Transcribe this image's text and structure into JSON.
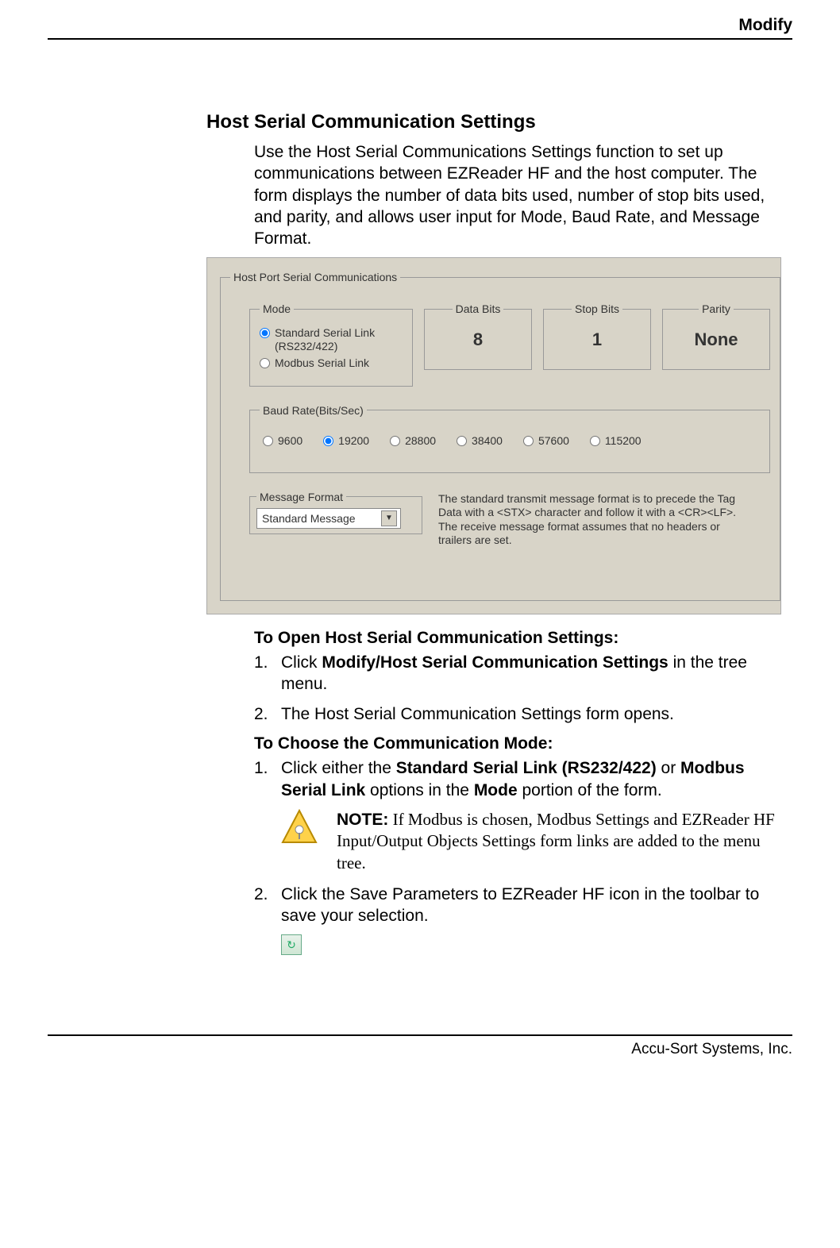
{
  "header": {
    "title": "Modify"
  },
  "section": {
    "title": "Host Serial Communication Settings",
    "intro": "Use the Host Serial Communications Settings function to set up communications between EZReader HF and the host computer. The form displays the number of data bits used, number of stop bits used, and parity, and allows user input for Mode, Baud Rate, and Message Format."
  },
  "ui": {
    "outer_legend": "Host Port Serial Communications",
    "mode": {
      "legend": "Mode",
      "opt1": "Standard Serial Link (RS232/422)",
      "opt2": "Modbus Serial Link",
      "selected": 0
    },
    "databits": {
      "legend": "Data Bits",
      "value": "8"
    },
    "stopbits": {
      "legend": "Stop Bits",
      "value": "1"
    },
    "parity": {
      "legend": "Parity",
      "value": "None"
    },
    "baud": {
      "legend": "Baud Rate(Bits/Sec)",
      "options": [
        "9600",
        "19200",
        "28800",
        "38400",
        "57600",
        "115200"
      ],
      "selected": 1
    },
    "msgfmt": {
      "legend": "Message Format",
      "value": "Standard Message",
      "desc": "The standard transmit message format is to precede the Tag Data with a <STX> character and follow it with a <CR><LF>. The receive message format assumes that no headers or trailers are set."
    }
  },
  "howto": {
    "open_head": "To Open Host Serial Communication Settings:",
    "open_s1a": "Click ",
    "open_s1b": "Modify/Host Serial Communication Settings",
    "open_s1c": " in the tree menu.",
    "open_s2": "The Host Serial Communication Settings form opens.",
    "mode_head": "To Choose the Communication Mode:",
    "mode_s1a": "Click either the ",
    "mode_s1b": "Standard Serial Link (RS232/422)",
    "mode_s1c": " or ",
    "mode_s1d": "Modbus Serial Link",
    "mode_s1e": " options in the ",
    "mode_s1f": "Mode",
    "mode_s1g": " portion of the form.",
    "note_label": "NOTE:",
    "note_text": " If Modbus is chosen, Modbus Settings and EZReader HF Input/Output Objects Settings form links are added to the menu tree.",
    "mode_s2": "Click the Save Parameters to EZReader HF icon in the toolbar to save your selection."
  },
  "footer": {
    "company": "Accu-Sort Systems, Inc."
  }
}
